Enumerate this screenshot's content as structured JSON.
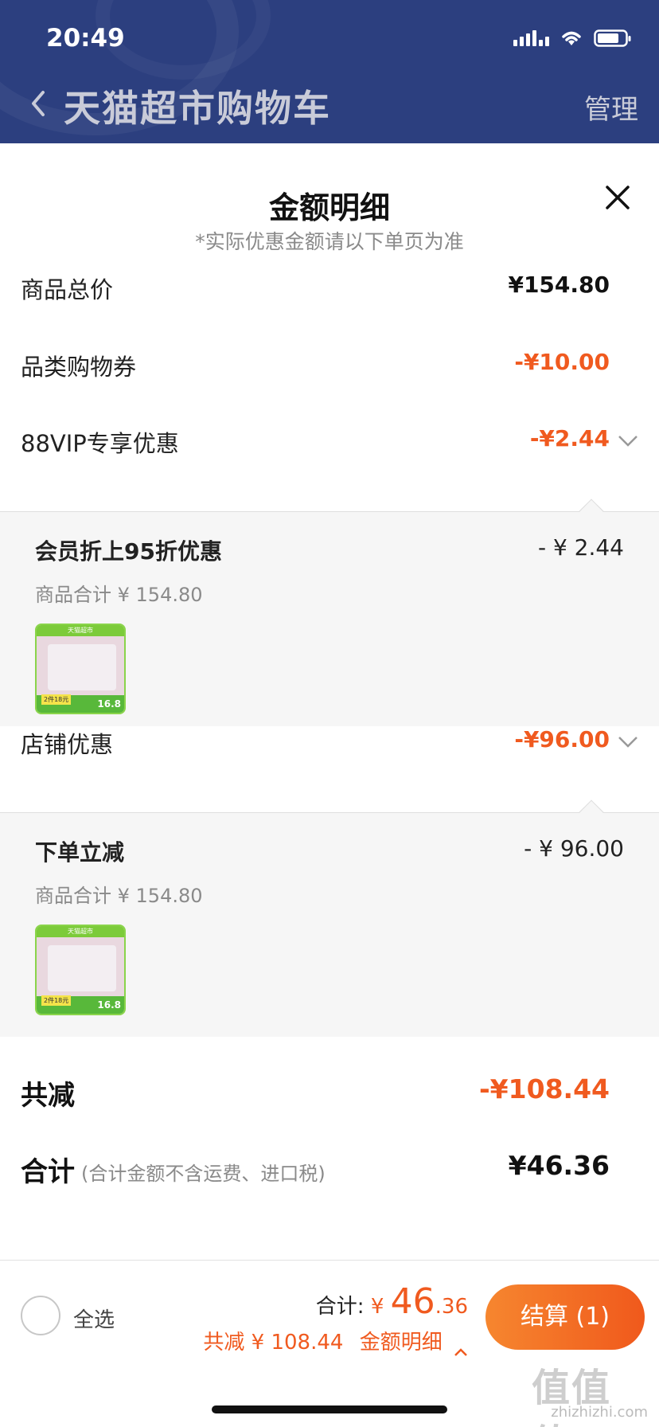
{
  "status_bar": {
    "time": "20:49"
  },
  "nav": {
    "title": "天猫超市购物车",
    "manage": "管理"
  },
  "panel": {
    "title": "金额明细",
    "subtitle": "*实际优惠金额请以下单页为准",
    "rows": {
      "goods_total": {
        "label": "商品总价",
        "value": "¥154.80"
      },
      "category_coupon": {
        "label": "品类购物券",
        "value": "-¥10.00"
      },
      "vip_discount": {
        "label": "88VIP专享优惠",
        "value": "-¥2.44"
      },
      "store_discount": {
        "label": "店铺优惠",
        "value": "-¥96.00"
      }
    },
    "vip_detail": {
      "title": "会员折上95折优惠",
      "amount": "- ¥ 2.44",
      "subtotal": "商品合计 ¥ 154.80",
      "thumb": {
        "top_text": "天猫超市",
        "badge": "2件18元",
        "price": "16.8"
      }
    },
    "store_detail": {
      "title": "下单立减",
      "amount": "- ¥ 96.00",
      "subtotal": "商品合计 ¥ 154.80",
      "thumb": {
        "top_text": "天猫超市",
        "badge": "2件18元",
        "price": "16.8"
      }
    },
    "total_saving": {
      "label": "共减",
      "value": "-¥108.44"
    },
    "grand_total": {
      "label": "合计",
      "note": "(合计金额不含运费、进口税)",
      "value": "¥46.36"
    }
  },
  "bottom_bar": {
    "select_all": "全选",
    "total_prefix": "合计:",
    "currency": "¥",
    "total_int": "46",
    "total_dec": ".36",
    "saving_text": "共减 ¥ 108.44",
    "detail_link": "金额明细",
    "checkout": "结算 (1)"
  },
  "watermark": {
    "glyphs": "值值值",
    "url": "zhizhizhi.com"
  },
  "colors": {
    "header_bg": "#2c3f7f",
    "accent_orange": "#f05a1f",
    "detail_bg": "#f6f6f6"
  }
}
